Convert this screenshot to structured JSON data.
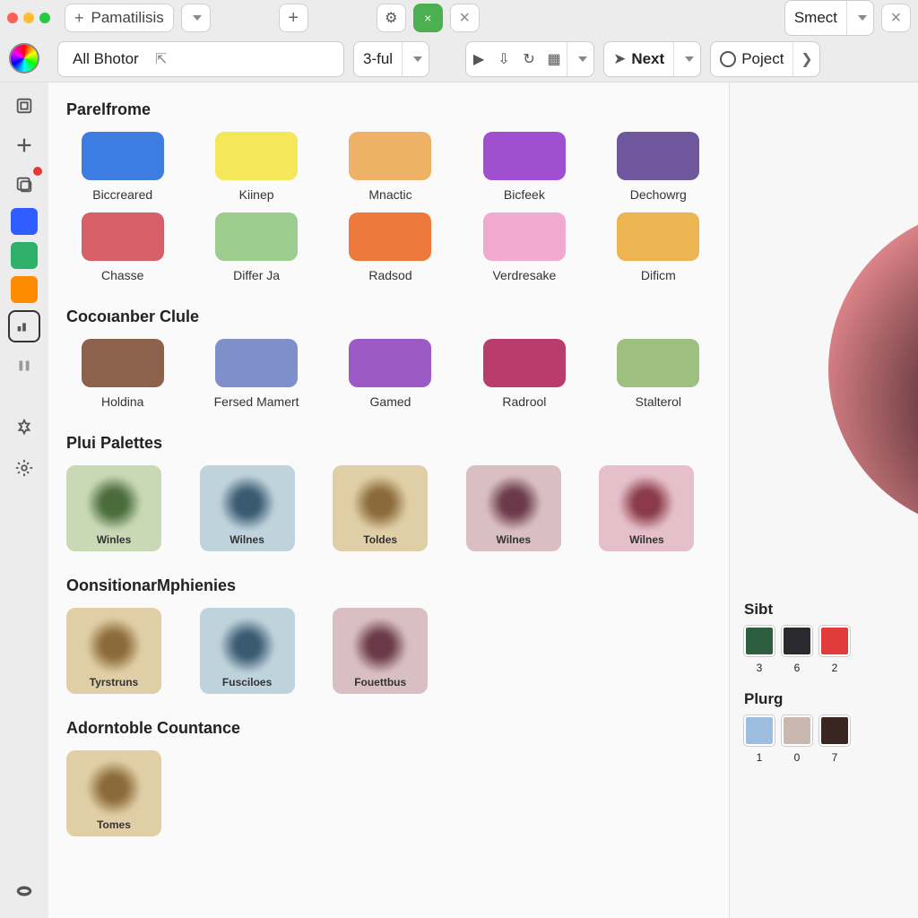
{
  "titlebar": {
    "tab_main": "Pamatilisis",
    "tab_right": "Smect"
  },
  "toolbar": {
    "filter_label": "All Bhotor",
    "filter_color": "#5b3cc4",
    "mode_label": "3-ful",
    "next_label": "Next",
    "project_label": "Poject"
  },
  "sidebar_swatches": [
    "#2f5dff",
    "#2fb06a",
    "#ff8c00"
  ],
  "sections": {
    "s1_title": "Parelfrome",
    "s1_items": [
      {
        "color": "#3d7ce0",
        "label": "Biccreared"
      },
      {
        "color": "#f4e759",
        "label": "Kiinep"
      },
      {
        "color": "#eeb267",
        "label": "Mnactic"
      },
      {
        "color": "#a04fd1",
        "label": "Bicfeek"
      },
      {
        "color": "#6e579d",
        "label": "Dechowrg"
      },
      {
        "color": "#d56068",
        "label": "Chasse"
      },
      {
        "color": "#9dcd8e",
        "label": "Differ Ja"
      },
      {
        "color": "#ed7a3c",
        "label": "Radsod"
      },
      {
        "color": "#f0a9cf",
        "label": "Verdresake"
      },
      {
        "color": "#ecb552",
        "label": "Dificm"
      }
    ],
    "s2_title": "Cocoιanber Clule",
    "s2_items": [
      {
        "color": "#8c624d",
        "label": "Holdina"
      },
      {
        "color": "#7e8fc9",
        "label": "Fersed Mamert"
      },
      {
        "color": "#9c5bc4",
        "label": "Gamed"
      },
      {
        "color": "#b93d6c",
        "label": "Radrool"
      },
      {
        "color": "#9dbf7f",
        "label": "Stalterol"
      }
    ],
    "s3_title": "Plui Palettes",
    "s3_items": [
      {
        "bg": "#c9d9b5",
        "blob": "#4a6b3a",
        "label": "Winles"
      },
      {
        "bg": "#bfd3dc",
        "blob": "#3a5a72",
        "label": "Wilnes"
      },
      {
        "bg": "#e0cfa6",
        "blob": "#8a6a3a",
        "label": "Toldes"
      },
      {
        "bg": "#d9bfc3",
        "blob": "#6b3a4a",
        "label": "Wilnes"
      },
      {
        "bg": "#e5bfc9",
        "blob": "#8a3a4a",
        "label": "Wilnes"
      }
    ],
    "s4_title": "OonsitionarMphienies",
    "s4_items": [
      {
        "bg": "#e0cfa6",
        "blob": "#8a6a3a",
        "label": "Tyrstruns"
      },
      {
        "bg": "#bfd3dc",
        "blob": "#3a5a72",
        "label": "Fuscilоes"
      },
      {
        "bg": "#d9bfc3",
        "blob": "#6b3a4a",
        "label": "Fouettbus"
      }
    ],
    "s5_title": "Adorntoble Countance",
    "s5_items": [
      {
        "bg": "#e0cfa6",
        "blob": "#8a6a3a",
        "label": "Tomes"
      }
    ]
  },
  "right": {
    "preview_color_outer": "#e88b90",
    "preview_color_inner": "#2a1518",
    "sibt_label": "Sibt",
    "sibt_items": [
      {
        "color": "#2d5e3f",
        "label": "3"
      },
      {
        "color": "#2a2a2e",
        "label": "6"
      },
      {
        "color": "#e23b3b",
        "label": "2"
      }
    ],
    "plurg_label": "Plurg",
    "plurg_items": [
      {
        "color": "#9dbde0",
        "label": "1"
      },
      {
        "color": "#c9b8b0",
        "label": "0"
      },
      {
        "color": "#3a2620",
        "label": "7"
      }
    ]
  }
}
